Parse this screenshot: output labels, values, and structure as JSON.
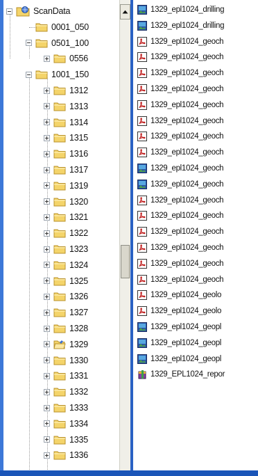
{
  "tree": {
    "root": {
      "label": "ScanData",
      "icon": "data-folder-icon",
      "expanded": true
    },
    "children": [
      {
        "label": "0001_050",
        "expander": "none"
      },
      {
        "label": "0501_100",
        "expander": "minus",
        "children": [
          {
            "label": "0556",
            "expander": "plus"
          }
        ]
      },
      {
        "label": "1001_150",
        "expander": "minus",
        "children": [
          {
            "label": "1312",
            "expander": "plus"
          },
          {
            "label": "1313",
            "expander": "plus"
          },
          {
            "label": "1314",
            "expander": "plus"
          },
          {
            "label": "1315",
            "expander": "plus"
          },
          {
            "label": "1316",
            "expander": "plus"
          },
          {
            "label": "1317",
            "expander": "plus"
          },
          {
            "label": "1319",
            "expander": "plus"
          },
          {
            "label": "1320",
            "expander": "plus"
          },
          {
            "label": "1321",
            "expander": "plus"
          },
          {
            "label": "1322",
            "expander": "plus"
          },
          {
            "label": "1323",
            "expander": "plus"
          },
          {
            "label": "1324",
            "expander": "plus"
          },
          {
            "label": "1325",
            "expander": "plus"
          },
          {
            "label": "1326",
            "expander": "plus"
          },
          {
            "label": "1327",
            "expander": "plus"
          },
          {
            "label": "1328",
            "expander": "plus"
          },
          {
            "label": "1329",
            "expander": "plus",
            "selected_open": true
          },
          {
            "label": "1330",
            "expander": "plus"
          },
          {
            "label": "1331",
            "expander": "plus"
          },
          {
            "label": "1332",
            "expander": "plus"
          },
          {
            "label": "1333",
            "expander": "plus"
          },
          {
            "label": "1334",
            "expander": "plus"
          },
          {
            "label": "1335",
            "expander": "plus"
          },
          {
            "label": "1336",
            "expander": "plus"
          }
        ]
      }
    ]
  },
  "files": [
    {
      "name": "1329_epl1024_drilling",
      "icon": "image-file-icon"
    },
    {
      "name": "1329_epl1024_drilling",
      "icon": "image-file-icon"
    },
    {
      "name": "1329_epl1024_geoch",
      "icon": "acrobat-file-icon"
    },
    {
      "name": "1329_epl1024_geoch",
      "icon": "acrobat-file-icon"
    },
    {
      "name": "1329_epl1024_geoch",
      "icon": "acrobat-file-icon"
    },
    {
      "name": "1329_epl1024_geoch",
      "icon": "acrobat-file-icon"
    },
    {
      "name": "1329_epl1024_geoch",
      "icon": "acrobat-file-icon"
    },
    {
      "name": "1329_epl1024_geoch",
      "icon": "acrobat-file-icon"
    },
    {
      "name": "1329_epl1024_geoch",
      "icon": "acrobat-file-icon"
    },
    {
      "name": "1329_epl1024_geoch",
      "icon": "acrobat-file-icon"
    },
    {
      "name": "1329_epl1024_geoch",
      "icon": "image-file-icon"
    },
    {
      "name": "1329_epl1024_geoch",
      "icon": "image-file-icon"
    },
    {
      "name": "1329_epl1024_geoch",
      "icon": "acrobat-file-icon"
    },
    {
      "name": "1329_epl1024_geoch",
      "icon": "acrobat-file-icon"
    },
    {
      "name": "1329_epl1024_geoch",
      "icon": "acrobat-file-icon"
    },
    {
      "name": "1329_epl1024_geoch",
      "icon": "acrobat-file-icon"
    },
    {
      "name": "1329_epl1024_geoch",
      "icon": "acrobat-file-icon"
    },
    {
      "name": "1329_epl1024_geoch",
      "icon": "acrobat-file-icon"
    },
    {
      "name": "1329_epl1024_geolo",
      "icon": "acrobat-file-icon"
    },
    {
      "name": "1329_epl1024_geolo",
      "icon": "acrobat-file-icon"
    },
    {
      "name": "1329_epl1024_geopl",
      "icon": "image-file-icon"
    },
    {
      "name": "1329_epl1024_geopl",
      "icon": "image-file-icon"
    },
    {
      "name": "1329_epl1024_geopl",
      "icon": "image-file-icon"
    },
    {
      "name": "1329_EPL1024_repor",
      "icon": "package-file-icon"
    }
  ],
  "colors": {
    "folder_yellow": "#f4d46a",
    "folder_edge": "#b8912a",
    "frame_blue": "#1a55b8"
  }
}
